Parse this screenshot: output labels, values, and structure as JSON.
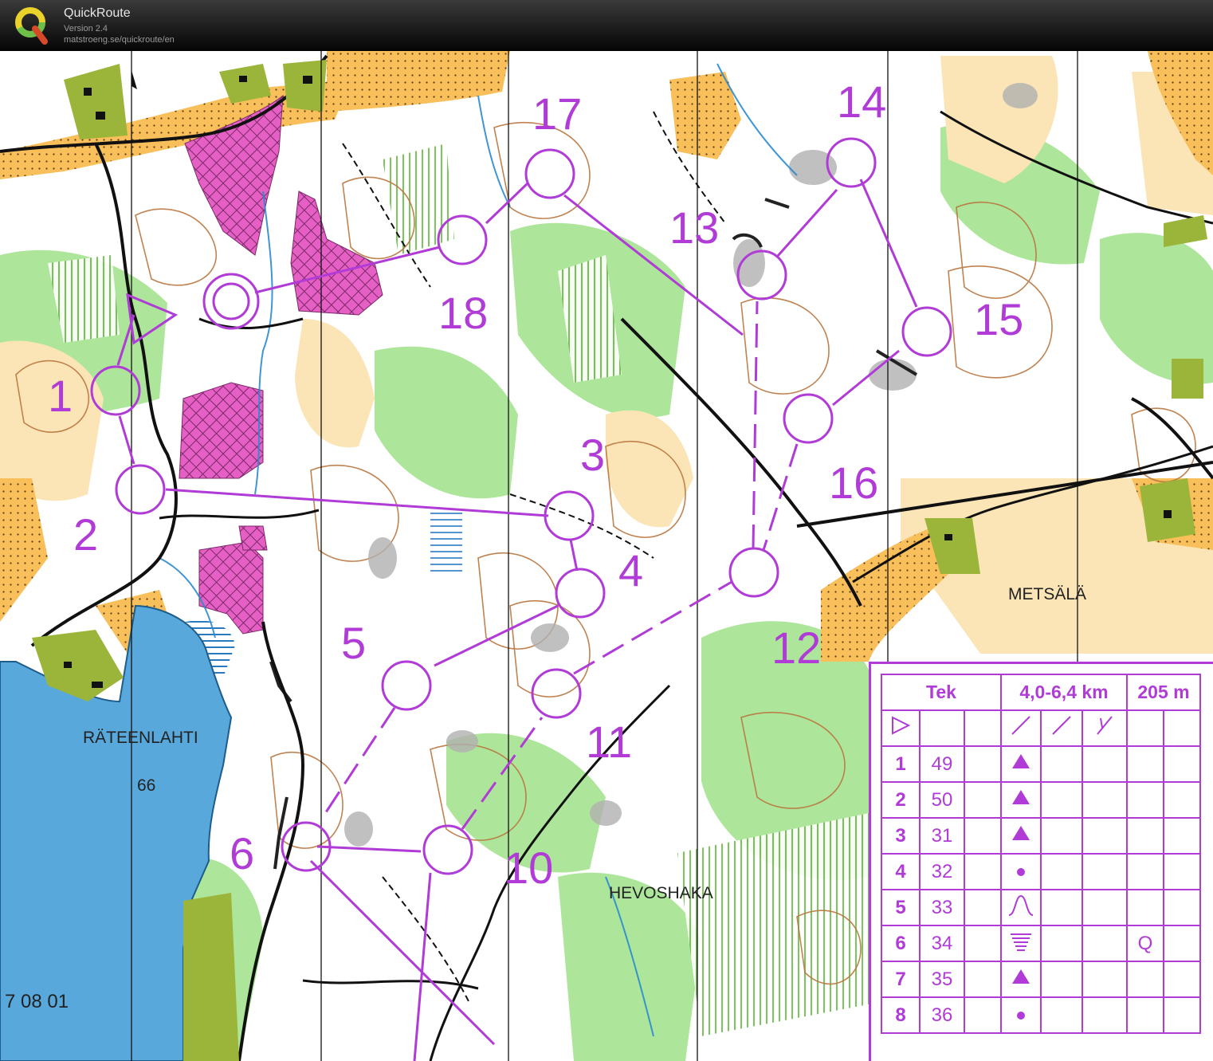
{
  "app": {
    "title": "QuickRoute",
    "version": "Version 2.4",
    "url": "matstroeng.se/quickroute/en"
  },
  "map": {
    "place_names": {
      "lake": "RÄTEENLAHTI",
      "spot_height": "66",
      "hevoshaka": "HEVOSHAKA",
      "metsala": "METSÄLÄ",
      "map_code": "7 08 01"
    },
    "control_labels": [
      "1",
      "2",
      "3",
      "4",
      "5",
      "6",
      "10",
      "11",
      "12",
      "13",
      "14",
      "15",
      "16",
      "17",
      "18"
    ],
    "colors": {
      "course": "#b03bd6",
      "water": "#58a8dc",
      "open_land": "#f9bf5a",
      "rough_open": "#fbe5b6",
      "forest": "#ffffff",
      "green": "#90d878",
      "private": "#e65fc4",
      "cliff": "#222222",
      "contour": "#b9753f"
    }
  },
  "description": {
    "header": {
      "class": "Tek",
      "length": "4,0-6,4 km",
      "climb": "205 m"
    },
    "rows": [
      {
        "num": "1",
        "code": "49",
        "symbol": "triangle"
      },
      {
        "num": "2",
        "code": "50",
        "symbol": "triangle"
      },
      {
        "num": "3",
        "code": "31",
        "symbol": "triangle"
      },
      {
        "num": "4",
        "code": "32",
        "symbol": "dot"
      },
      {
        "num": "5",
        "code": "33",
        "symbol": "knoll"
      },
      {
        "num": "6",
        "code": "34",
        "symbol": "marsh",
        "extra": "Q"
      },
      {
        "num": "7",
        "code": "35",
        "symbol": "triangle"
      },
      {
        "num": "8",
        "code": "36",
        "symbol": "dot"
      }
    ]
  }
}
